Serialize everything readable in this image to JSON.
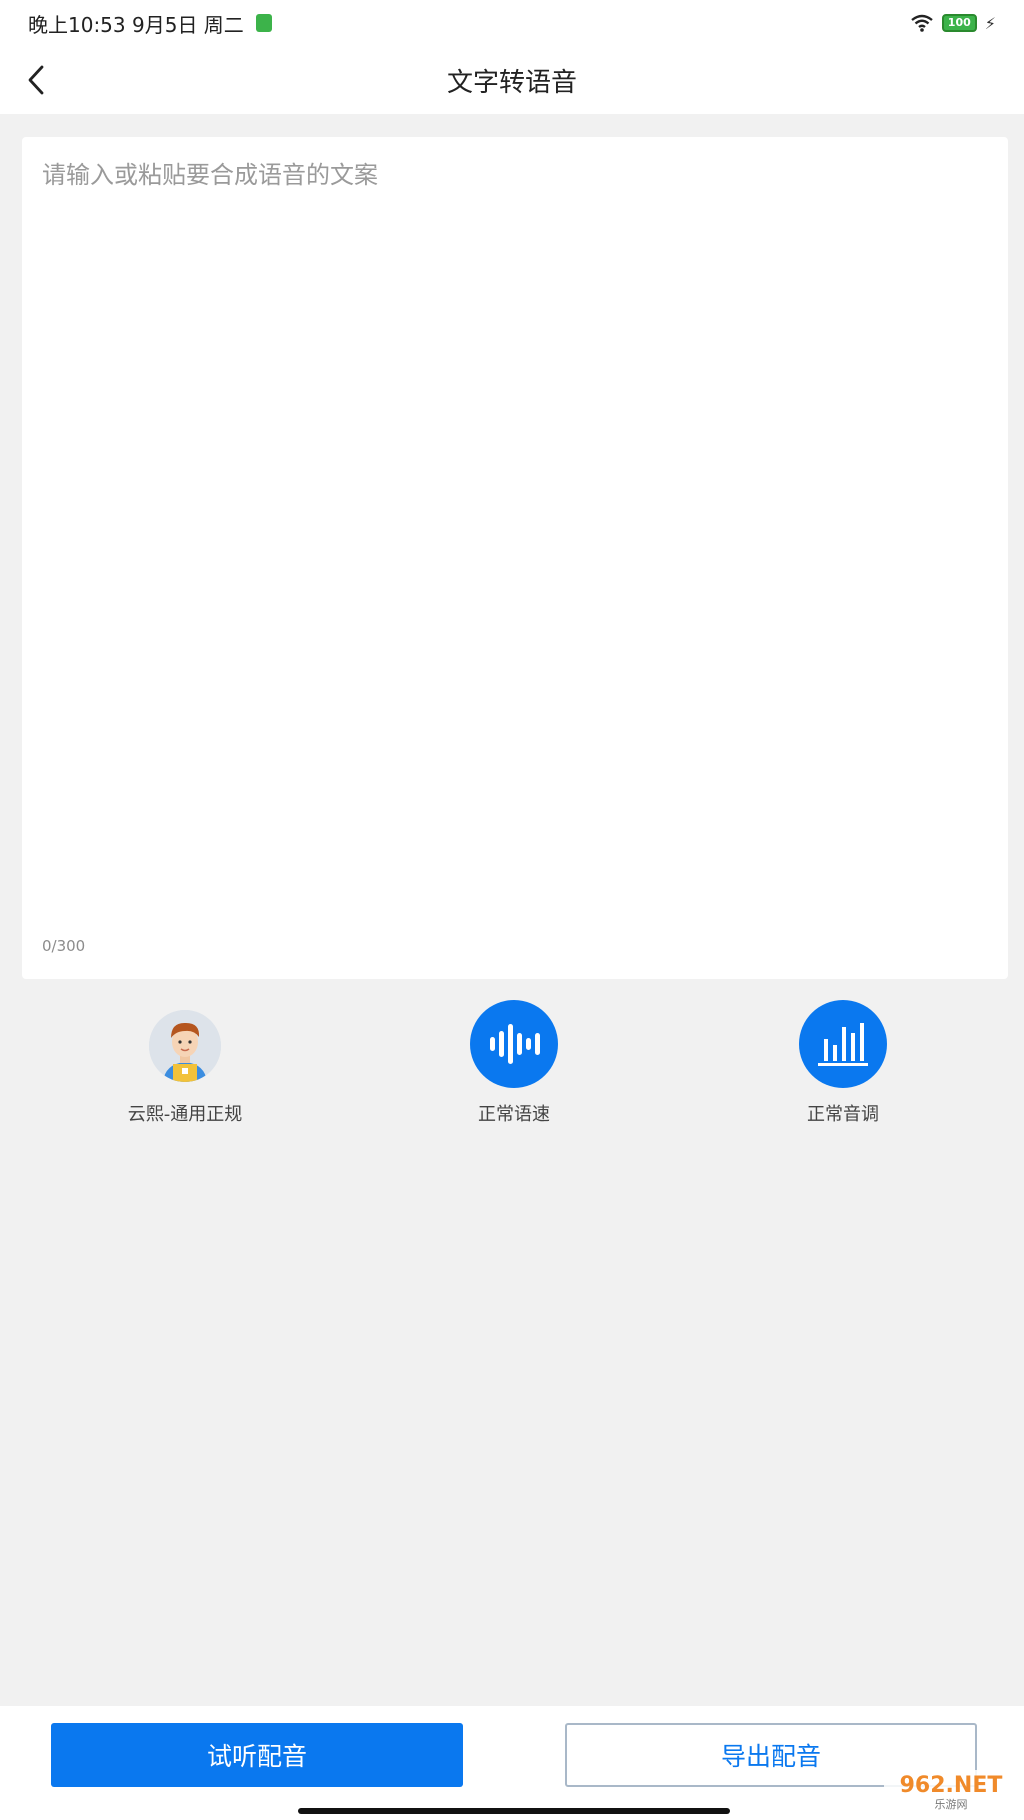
{
  "status_bar": {
    "time": "晚上10:53 9月5日 周二",
    "battery": "100"
  },
  "nav": {
    "title": "文字转语音"
  },
  "editor": {
    "placeholder": "请输入或粘贴要合成语音的文案",
    "value": "",
    "counter": "0/300"
  },
  "options": {
    "voice_label": "云熙-通用正规",
    "speed_label": "正常语速",
    "pitch_label": "正常音调"
  },
  "actions": {
    "listen_label": "试听配音",
    "export_label": "导出配音"
  },
  "watermark": {
    "main": "962.NET",
    "sub": "乐游网"
  },
  "colors": {
    "accent": "#0a78ef",
    "background": "#f1f1f1",
    "card": "#ffffff"
  }
}
